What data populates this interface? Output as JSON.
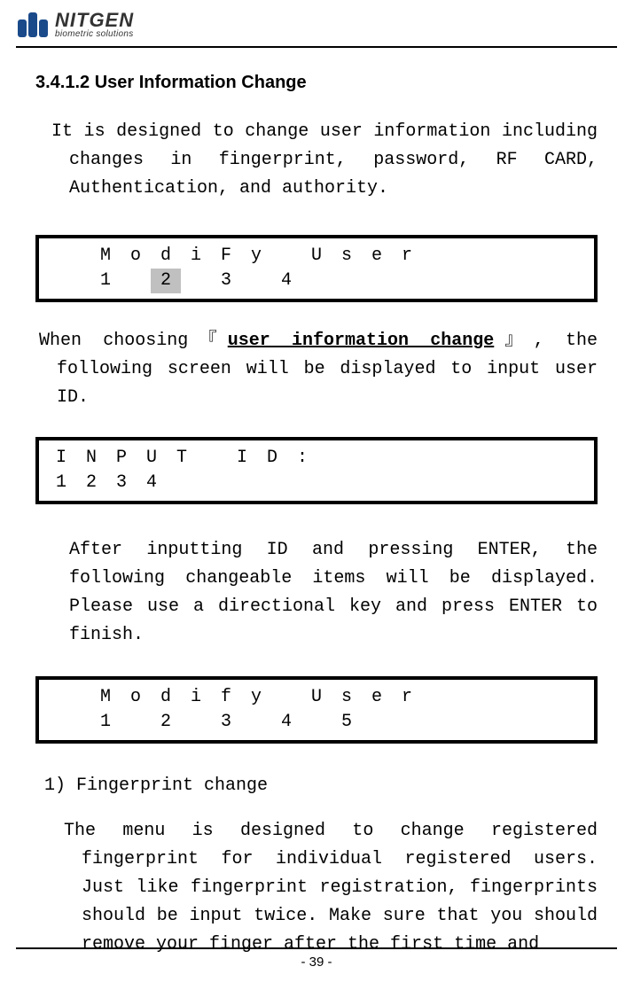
{
  "header": {
    "logo_name": "NITGEN",
    "logo_tagline": "biometric solutions"
  },
  "section_title": "3.4.1.2 User Information Change",
  "para1": "It is designed to change user information including changes in fingerprint, password, RF CARD, Authentication, and authority.",
  "lcd1": {
    "row1": [
      "",
      "M",
      "o",
      "d",
      "i",
      "F",
      "y",
      "",
      "U",
      "s",
      "e",
      "r",
      "",
      "",
      "",
      ""
    ],
    "row2": [
      "",
      "1",
      "",
      "2",
      "",
      "3",
      "",
      "4",
      "",
      "",
      "",
      "",
      "",
      "",
      "",
      ""
    ]
  },
  "para2a": "When choosing『",
  "para2b": "user information change",
  "para2c": "』, the following screen will be displayed to input user ID.",
  "lcd2": {
    "row1": [
      "I",
      "N",
      "P",
      "U",
      "T",
      "",
      "I",
      "D",
      ":",
      "",
      "",
      "",
      "",
      "",
      "",
      ""
    ],
    "row2": [
      "1",
      "2",
      "3",
      "4",
      "",
      "",
      "",
      "",
      "",
      "",
      "",
      "",
      "",
      "",
      "",
      ""
    ]
  },
  "para3": "After inputting ID and pressing ENTER, the following changeable items will be displayed. Please use a directional key and press ENTER to finish.",
  "lcd3": {
    "row1": [
      "",
      "M",
      "o",
      "d",
      "i",
      "f",
      "y",
      "",
      "U",
      "s",
      "e",
      "r",
      "",
      "",
      "",
      ""
    ],
    "row2": [
      "",
      "1",
      "",
      "2",
      "",
      "3",
      "",
      "4",
      "",
      "5",
      "",
      "",
      "",
      "",
      "",
      ""
    ]
  },
  "subhead1": "1) Fingerprint change",
  "para4": "The menu is designed to change registered fingerprint for individual registered users. Just like fingerprint registration, fingerprints should be input twice. Make sure that you should remove your finger after the first time and",
  "pagenum": "- 39 -"
}
